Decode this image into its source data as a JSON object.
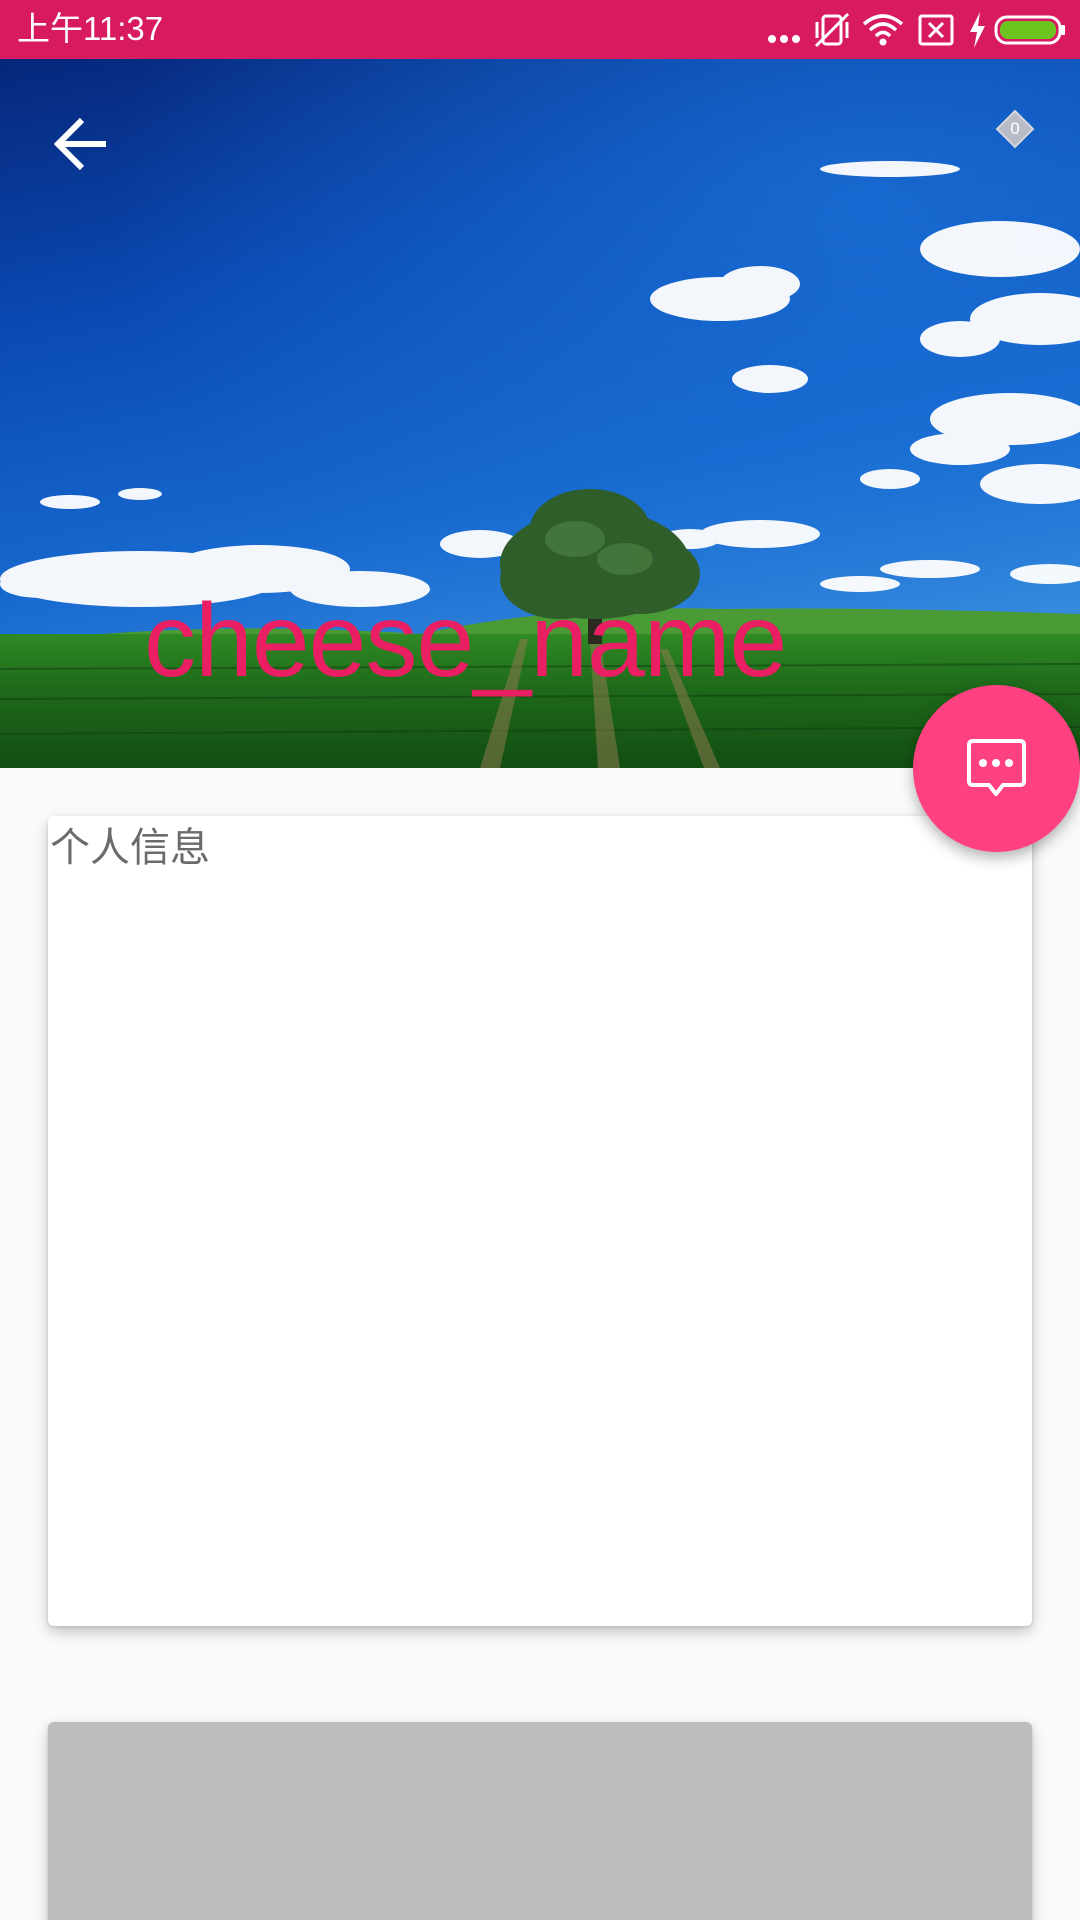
{
  "status_bar": {
    "time": "上午11:37",
    "icons": [
      "more-dots-icon",
      "vibrate-off-icon",
      "wifi-icon",
      "sim-off-icon",
      "charging-icon",
      "battery-icon"
    ],
    "background_color": "#d81b60",
    "battery_color": "#6cc51f"
  },
  "header": {
    "title": "cheese_name",
    "title_color": "#e91e63",
    "back_icon": "arrow-back-icon",
    "badge": {
      "icon": "diamond-badge-icon",
      "count": "0"
    }
  },
  "fab": {
    "icon": "chat-bubble-icon",
    "color": "#ff4081"
  },
  "cards": [
    {
      "title": "个人信息"
    }
  ]
}
